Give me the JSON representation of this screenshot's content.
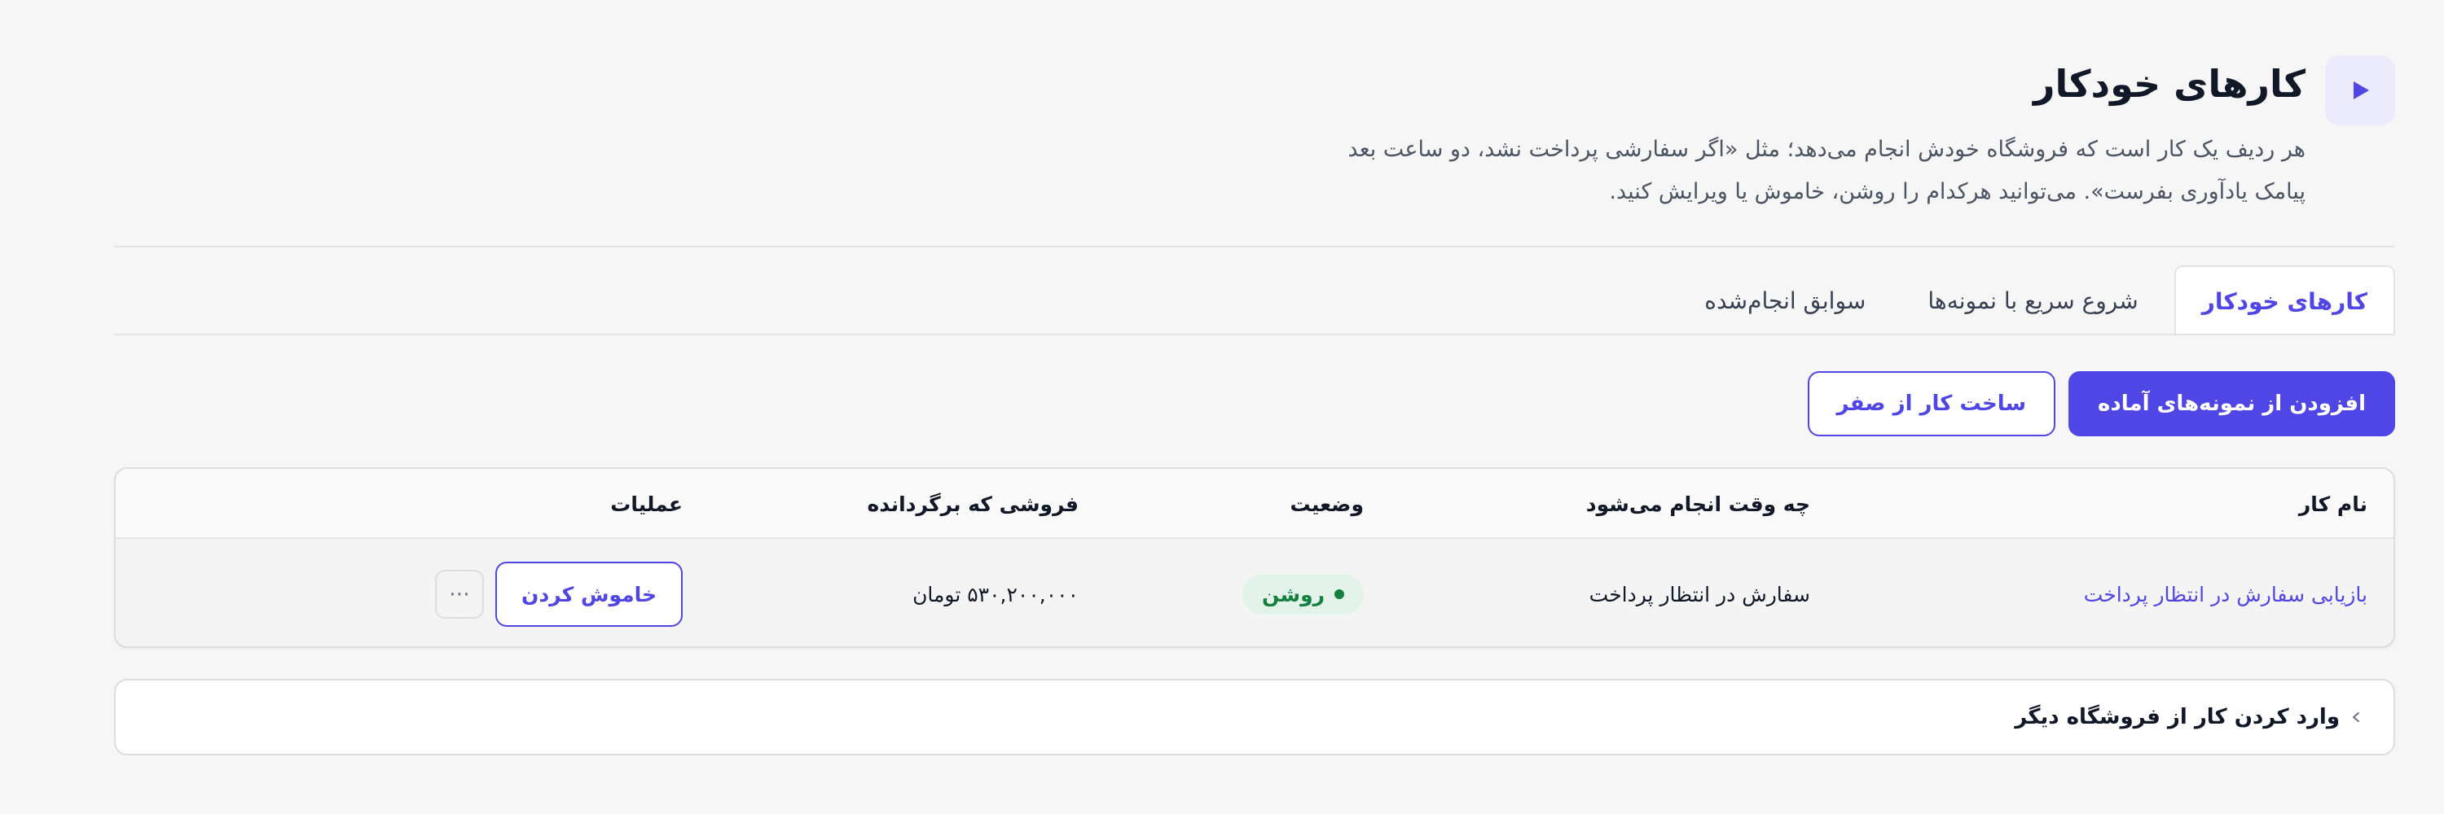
{
  "header": {
    "title": "کارهای خودکار",
    "description": "هر ردیف یک کار است که فروشگاه خودش انجام می‌دهد؛ مثل «اگر سفارشی پرداخت نشد، دو ساعت بعد پیامک یادآوری بفرست». می‌توانید هرکدام را روشن، خاموش یا ویرایش کنید.",
    "icon": "play-icon",
    "accent_color": "#4f46e5"
  },
  "tabs": [
    {
      "label": "کارهای خودکار",
      "active": true
    },
    {
      "label": "شروع سریع با نمونه‌ها",
      "active": false
    },
    {
      "label": "سوابق انجام‌شده",
      "active": false
    }
  ],
  "actions": {
    "primary_label": "افزودن از نمونه‌های آماده",
    "secondary_label": "ساخت کار از صفر"
  },
  "table": {
    "columns": {
      "name": "نام کار",
      "when": "چه وقت انجام می‌شود",
      "status": "وضعیت",
      "recovered": "فروشی که برگردانده",
      "operations": "عملیات"
    },
    "rows": [
      {
        "name": "بازیابی سفارش در انتظار پرداخت",
        "when": "سفارش در انتظار پرداخت",
        "status": "روشن",
        "status_color": "#15803d",
        "recovered": "۵۳۰,۲۰۰,۰۰۰ تومان",
        "toggle_label": "خاموش کردن",
        "more_label": "⋯"
      }
    ]
  },
  "import": {
    "label": "وارد کردن کار از فروشگاه دیگر",
    "icon": "chevron-left-icon"
  }
}
